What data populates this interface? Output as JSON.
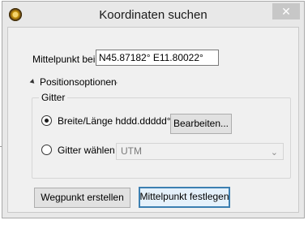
{
  "window": {
    "title": "Koordinaten suchen",
    "close_glyph": "✕"
  },
  "center": {
    "label": "Mittelpunkt bei",
    "value": "N45.87182° E11.80022°"
  },
  "position_options": {
    "label": "Positionsoptionen",
    "trailing": "-"
  },
  "gitter": {
    "legend": "Gitter",
    "option_latlon": {
      "label": "Breite/Länge hddd.ddddd°",
      "selected": true
    },
    "edit_label": "Bearbeiten...",
    "option_grid": {
      "label": "Gitter wählen",
      "selected": false
    },
    "grid_select": {
      "value": "UTM",
      "chevron": "⌄"
    }
  },
  "buttons": {
    "create_waypoint": "Wegpunkt erstellen",
    "set_center": "Mittelpunkt festlegen"
  },
  "icons": {
    "app": "app-compass-icon",
    "close": "close-icon"
  }
}
